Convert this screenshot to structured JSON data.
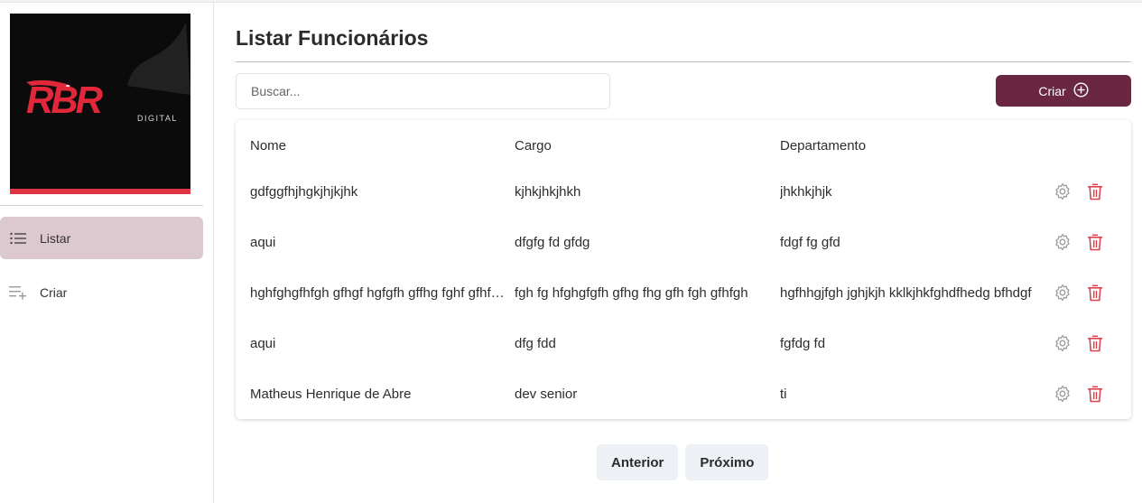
{
  "brand": {
    "logo_text": "RBR",
    "logo_subtext": "DIGITAL",
    "accent": "#e0283a"
  },
  "sidebar": {
    "items": [
      {
        "label": "Listar",
        "icon": "list-icon",
        "active": true
      },
      {
        "label": "Criar",
        "icon": "playlist-add-icon",
        "active": false
      }
    ]
  },
  "main": {
    "title": "Listar Funcionários",
    "search": {
      "placeholder": "Buscar...",
      "value": ""
    },
    "create_button": {
      "label": "Criar",
      "icon": "plus-circle-icon",
      "color": "#6a2741"
    },
    "table": {
      "headers": [
        "Nome",
        "Cargo",
        "Departamento"
      ],
      "rows": [
        [
          "gdfggfhjhgkjhjkjhk",
          "kjhkjhkjhkh",
          "jhkhkjhjk"
        ],
        [
          "aqui",
          "dfgfg fd gfdg",
          "fdgf fg gfd"
        ],
        [
          "hghfghgfhfgh gfhgf hgfgfh gffhg fghf gfhfgh",
          "fgh fg hfghgfgfh gfhg fhg gfh fgh gfhfgh",
          "hgfhhgjfgh jghjkjh kklkjhkfghdfhedg bfhdgf"
        ],
        [
          "aqui",
          "dfg fdd",
          "fgfdg fd"
        ],
        [
          "Matheus Henrique de Abre",
          "dev senior",
          "ti"
        ]
      ],
      "row_actions": [
        {
          "icon": "gear-icon",
          "color": "#9a9a9a"
        },
        {
          "icon": "trash-icon",
          "color": "#e0404e"
        }
      ]
    },
    "pagination": {
      "prev_label": "Anterior",
      "next_label": "Próximo"
    }
  }
}
